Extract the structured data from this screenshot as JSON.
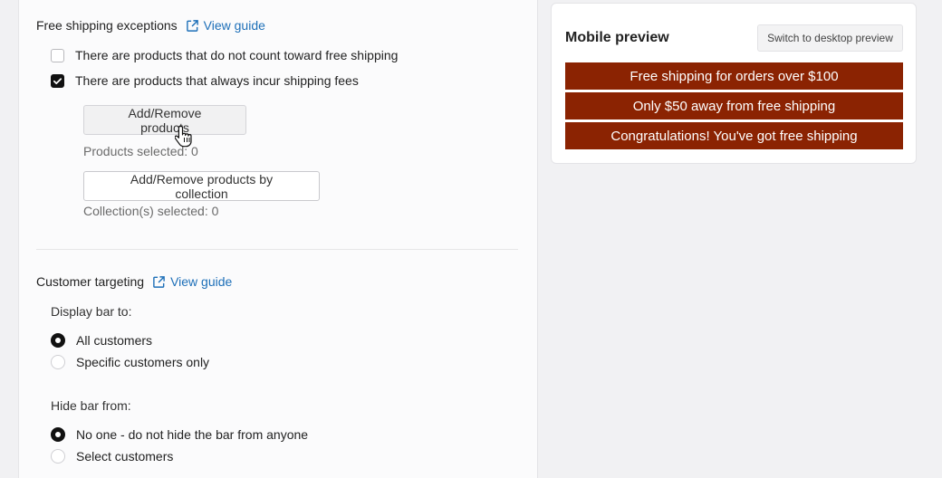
{
  "free_shipping_exceptions": {
    "title": "Free shipping exceptions",
    "guide_link": "View guide",
    "option_not_count": "There are products that do not count toward free shipping",
    "option_always_fee": "There are products that always incur shipping fees",
    "option_not_count_checked": false,
    "option_always_fee_checked": true,
    "add_remove_products": "Add/Remove products",
    "products_selected": "Products selected: 0",
    "add_remove_by_collection": "Add/Remove products by collection",
    "collections_selected": "Collection(s) selected: 0"
  },
  "customer_targeting": {
    "title": "Customer targeting",
    "guide_link": "View guide",
    "display_label": "Display bar to:",
    "display_options": [
      {
        "label": "All customers",
        "selected": true
      },
      {
        "label": "Specific customers only",
        "selected": false
      }
    ],
    "hide_label": "Hide bar from:",
    "hide_options": [
      {
        "label": "No one - do not hide the bar from anyone",
        "selected": true
      },
      {
        "label": "Select customers",
        "selected": false
      }
    ]
  },
  "preview": {
    "title": "Mobile preview",
    "switch_button": "Switch to desktop preview",
    "bars": [
      "Free shipping for orders over $100",
      "Only $50 away from free shipping",
      "Congratulations! You've got free shipping"
    ],
    "bar_color": "#8b2302",
    "bar_text_color": "#ffffff"
  },
  "icons": {
    "external_link": "external-link-icon",
    "cursor": "hand-pointer-cursor-icon",
    "checkmark": "checkmark-icon"
  }
}
